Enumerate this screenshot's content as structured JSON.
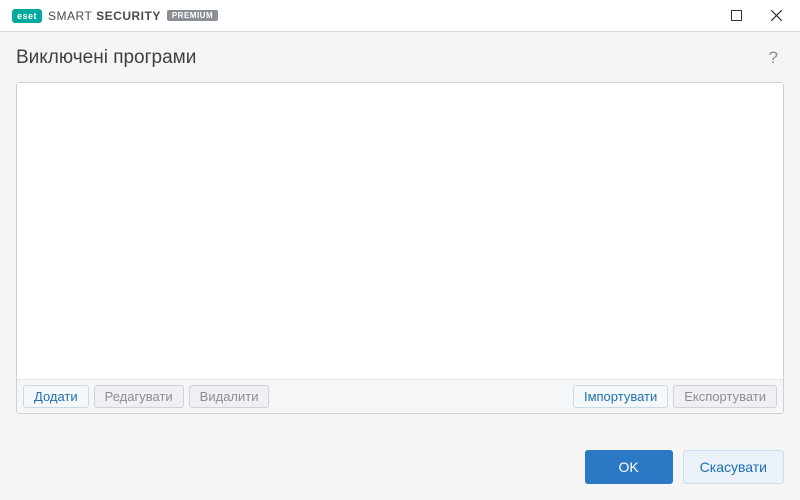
{
  "brand": {
    "logo_text": "eset",
    "name_thin": "SMART",
    "name_bold": "SECURITY",
    "badge": "PREMIUM"
  },
  "page": {
    "title": "Виключені програми"
  },
  "toolbar": {
    "add": "Додати",
    "edit": "Редагувати",
    "delete": "Видалити",
    "import": "Імпортувати",
    "export": "Експортувати"
  },
  "footer": {
    "ok": "OK",
    "cancel": "Скасувати"
  },
  "help": "?"
}
